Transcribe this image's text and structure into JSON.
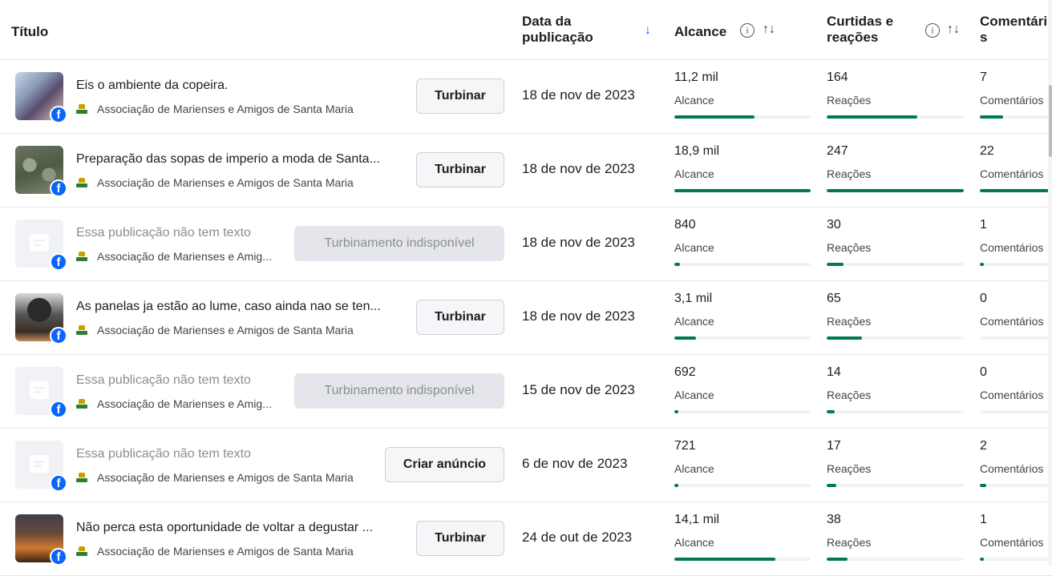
{
  "header": {
    "title": "Título",
    "date_line1": "Data da",
    "date_line2": "publicação",
    "reach": "Alcance",
    "reactions_line1": "Curtidas e",
    "reactions_line2": "reações",
    "comments_line1": "Comentári",
    "comments_line2": "s"
  },
  "colors": {
    "bar": "#007a55",
    "facebook": "#0866ff"
  },
  "rows": [
    {
      "thumb": "photo-kitchen",
      "title": "Eis o ambiente da copeira.",
      "muted": false,
      "page": "Associação de Marienses e Amigos de Santa Maria",
      "button": "Turbinar",
      "button_state": "enabled",
      "date": "18 de nov de 2023",
      "reach": "11,2 mil",
      "reach_label": "Alcance",
      "reach_fraction": 0.59,
      "reactions": "164",
      "reactions_label": "Reações",
      "reactions_fraction": 0.66,
      "comments": "7",
      "comments_label": "Comentários",
      "comments_fraction": 0.32
    },
    {
      "thumb": "photo-soup",
      "title": "Preparação das sopas de imperio a moda de Santa...",
      "muted": false,
      "page": "Associação de Marienses e Amigos de Santa Maria",
      "button": "Turbinar",
      "button_state": "enabled",
      "date": "18 de nov de 2023",
      "reach": "18,9 mil",
      "reach_label": "Alcance",
      "reach_fraction": 1.0,
      "reactions": "247",
      "reactions_label": "Reações",
      "reactions_fraction": 1.0,
      "comments": "22",
      "comments_label": "Comentários",
      "comments_fraction": 1.0
    },
    {
      "thumb": "placeholder",
      "title": "Essa publicação não tem texto",
      "muted": true,
      "page": "Associação de Marienses e Amig...",
      "button": "Turbinamento indisponível",
      "button_state": "disabled",
      "date": "18 de nov de 2023",
      "reach": "840",
      "reach_label": "Alcance",
      "reach_fraction": 0.04,
      "reactions": "30",
      "reactions_label": "Reações",
      "reactions_fraction": 0.12,
      "comments": "1",
      "comments_label": "Comentários",
      "comments_fraction": 0.05
    },
    {
      "thumb": "photo-pots",
      "title": "As panelas ja estão ao lume, caso ainda nao se ten...",
      "muted": false,
      "page": "Associação de Marienses e Amigos de Santa Maria",
      "button": "Turbinar",
      "button_state": "enabled",
      "date": "18 de nov de 2023",
      "reach": "3,1 mil",
      "reach_label": "Alcance",
      "reach_fraction": 0.16,
      "reactions": "65",
      "reactions_label": "Reações",
      "reactions_fraction": 0.26,
      "comments": "0",
      "comments_label": "Comentários",
      "comments_fraction": 0.0
    },
    {
      "thumb": "placeholder",
      "title": "Essa publicação não tem texto",
      "muted": true,
      "page": "Associação de Marienses e Amig...",
      "button": "Turbinamento indisponível",
      "button_state": "disabled",
      "date": "15 de nov de 2023",
      "reach": "692",
      "reach_label": "Alcance",
      "reach_fraction": 0.03,
      "reactions": "14",
      "reactions_label": "Reações",
      "reactions_fraction": 0.06,
      "comments": "0",
      "comments_label": "Comentários",
      "comments_fraction": 0.0
    },
    {
      "thumb": "placeholder",
      "title": "Essa publicação não tem texto",
      "muted": true,
      "page": "Associação de Marienses e Amigos de Santa Maria",
      "button": "Criar anúncio",
      "button_state": "enabled",
      "date": "6 de nov de 2023",
      "reach": "721",
      "reach_label": "Alcance",
      "reach_fraction": 0.03,
      "reactions": "17",
      "reactions_label": "Reações",
      "reactions_fraction": 0.07,
      "comments": "2",
      "comments_label": "Comentários",
      "comments_fraction": 0.09
    },
    {
      "thumb": "photo-event",
      "title": "Não perca esta oportunidade de voltar a degustar ...",
      "muted": false,
      "page": "Associação de Marienses e Amigos de Santa Maria",
      "button": "Turbinar",
      "button_state": "enabled",
      "date": "24 de out de 2023",
      "reach": "14,1 mil",
      "reach_label": "Alcance",
      "reach_fraction": 0.74,
      "reactions": "38",
      "reactions_label": "Reações",
      "reactions_fraction": 0.15,
      "comments": "1",
      "comments_label": "Comentários",
      "comments_fraction": 0.05
    }
  ]
}
